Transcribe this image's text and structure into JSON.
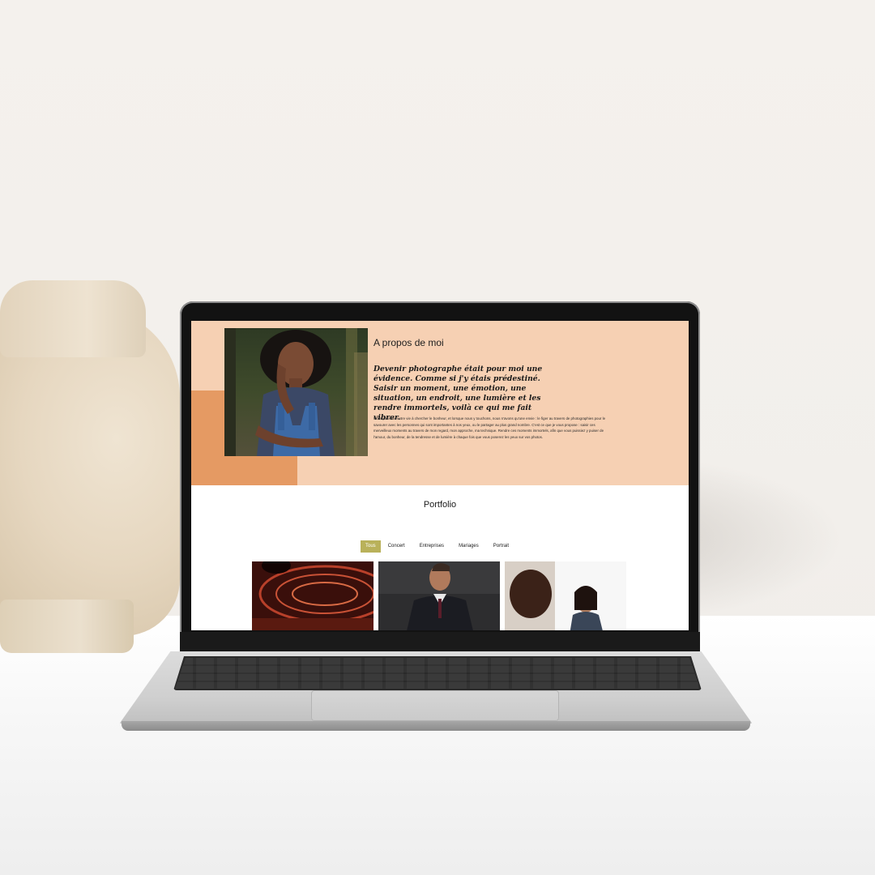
{
  "about": {
    "title": "A propos de moi",
    "quote": "Devenir photographe était pour moi une évidence. Comme si j'y étais prédestiné. Saisir un moment, une émotion, une situation, un endroit, une lumière et les rendre immortels, voilà ce qui me fait vibrer.",
    "body": "Nous passons notre vie à chercher le bonheur, et lorsque nous y touchons, nous n'avons qu'une envie : le figer au travers de photographies pour le savourer avec les personnes qui sont importantes à nos yeux, ou le partager au plus grand nombre. C'est ce que je vous propose : saisir ces merveilleux moments au travers de mon regard, mon approche, ma technique. Rendre ces moments immortels, afin que vous puissiez y puiser de l'amour, du bonheur, de la tendresse et de lumière à chaque fois que vous poserez les yeux sur vos photos."
  },
  "portfolio": {
    "title": "Portfolio",
    "filters": [
      "Tous",
      "Concert",
      "Entreprises",
      "Mariages",
      "Portrait"
    ],
    "active_filter": "Tous"
  },
  "colors": {
    "about_bg": "#f6d0b3",
    "accent": "#e59a63",
    "filter_active": "#b9b15a"
  }
}
